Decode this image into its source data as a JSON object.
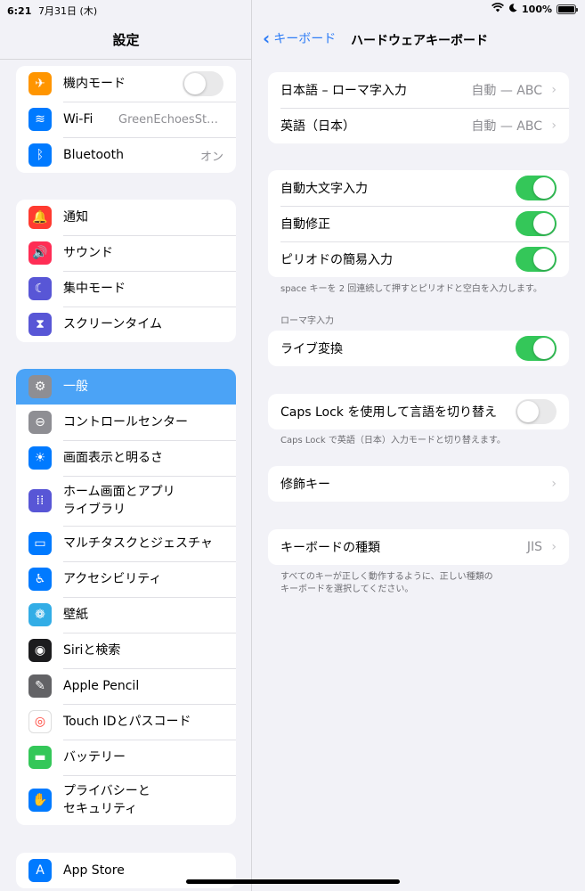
{
  "status": {
    "time": "6:21",
    "date": "7月31日 (木)",
    "battery": "100%"
  },
  "sidebar": {
    "title": "設定",
    "group1": [
      {
        "label": "機内モード",
        "icon": "airplane-icon",
        "color": "#ff9500",
        "toggle": false
      },
      {
        "label": "Wi-Fi",
        "icon": "wifi-icon",
        "color": "#007aff",
        "value": "GreenEchoesStudi..."
      },
      {
        "label": "Bluetooth",
        "icon": "bluetooth-icon",
        "color": "#007aff",
        "value": "オン"
      }
    ],
    "group2": [
      {
        "label": "通知",
        "icon": "bell-icon",
        "color": "#ff3b30"
      },
      {
        "label": "サウンド",
        "icon": "speaker-icon",
        "color": "#ff2d55"
      },
      {
        "label": "集中モード",
        "icon": "moon-icon",
        "color": "#5856d6"
      },
      {
        "label": "スクリーンタイム",
        "icon": "hourglass-icon",
        "color": "#5856d6"
      }
    ],
    "group3": [
      {
        "label": "一般",
        "icon": "gear-icon",
        "color": "#8e8e93",
        "selected": true
      },
      {
        "label": "コントロールセンター",
        "icon": "switches-icon",
        "color": "#8e8e93"
      },
      {
        "label": "画面表示と明るさ",
        "icon": "sun-icon",
        "color": "#007aff"
      },
      {
        "label": "ホーム画面とアプリ\nライブラリ",
        "icon": "home-grid-icon",
        "color": "#5856d6"
      },
      {
        "label": "マルチタスクとジェスチャ",
        "icon": "multitask-icon",
        "color": "#007aff"
      },
      {
        "label": "アクセシビリティ",
        "icon": "accessibility-icon",
        "color": "#007aff"
      },
      {
        "label": "壁紙",
        "icon": "flower-icon",
        "color": "#32ade6"
      },
      {
        "label": "Siriと検索",
        "icon": "siri-icon",
        "color": "#1c1c1e"
      },
      {
        "label": "Apple Pencil",
        "icon": "pencil-icon",
        "color": "#636366"
      },
      {
        "label": "Touch IDとパスコード",
        "icon": "fingerprint-icon",
        "color": "#ffffff"
      },
      {
        "label": "バッテリー",
        "icon": "battery-icon",
        "color": "#34c759"
      },
      {
        "label": "プライバシーと\nセキュリティ",
        "icon": "hand-icon",
        "color": "#007aff"
      }
    ],
    "group4": [
      {
        "label": "App Store",
        "icon": "appstore-icon",
        "color": "#007aff"
      }
    ]
  },
  "detail": {
    "back_label": "キーボード",
    "title": "ハードウェアキーボード",
    "group1": [
      {
        "label": "日本語 – ローマ字入力",
        "value": "自動 — ABC"
      },
      {
        "label": "英語（日本）",
        "value": "自動 — ABC"
      }
    ],
    "group2": [
      {
        "label": "自動大文字入力",
        "toggle": true
      },
      {
        "label": "自動修正",
        "toggle": true
      },
      {
        "label": "ピリオドの簡易入力",
        "toggle": true
      }
    ],
    "footnote1": "space キーを 2 回連続して押すとピリオドと空白を入力します。",
    "section_romaji": "ローマ字入力",
    "group3": [
      {
        "label": "ライブ変換",
        "toggle": true
      }
    ],
    "group4": [
      {
        "label": "Caps Lock を使用して言語を切り替え",
        "toggle": false
      }
    ],
    "footnote2": "Caps Lock で英語（日本）入力モードと切り替えます。",
    "group5": [
      {
        "label": "修飾キー"
      }
    ],
    "group6": [
      {
        "label": "キーボードの種類",
        "value": "JIS"
      }
    ],
    "footnote3": "すべてのキーが正しく動作するように、正しい種類の\nキーボードを選択してください。"
  }
}
